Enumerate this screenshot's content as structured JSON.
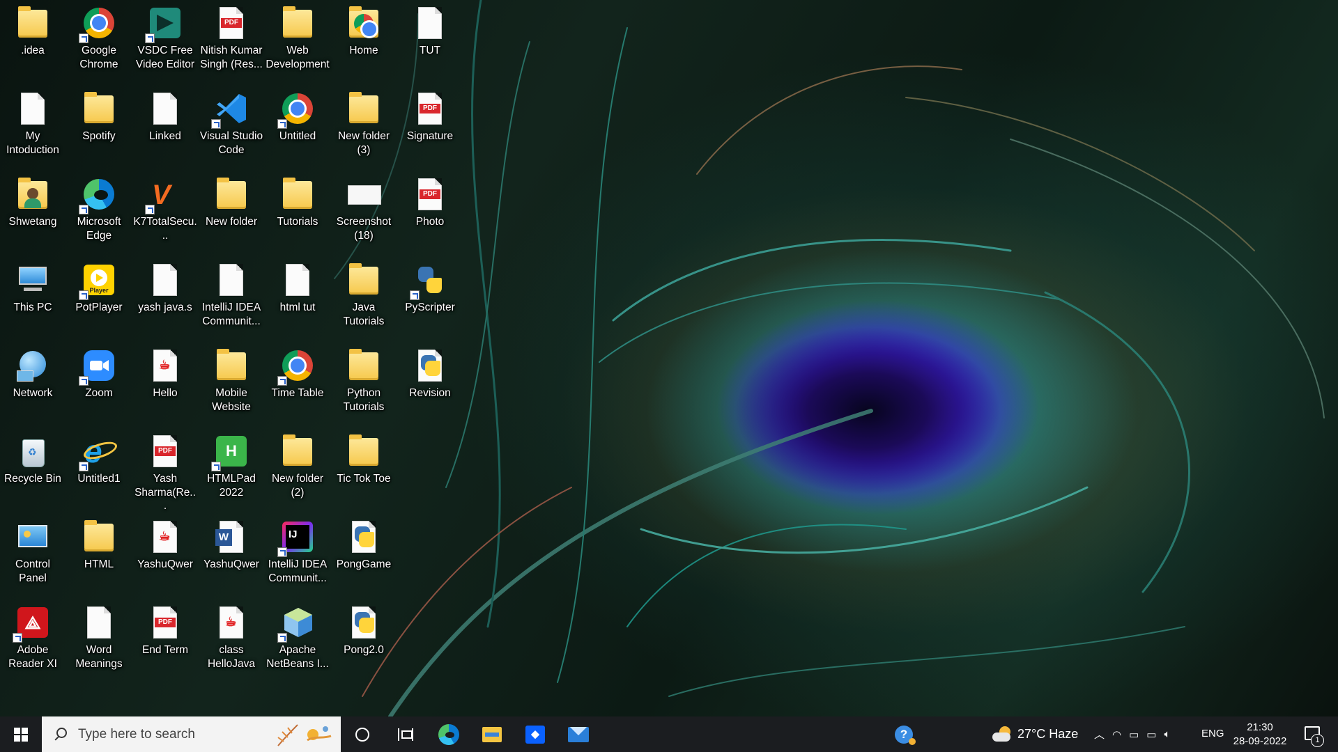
{
  "desktop": {
    "icons": [
      {
        "label": ".idea",
        "kind": "folder-icon"
      },
      {
        "label": "Google Chrome",
        "kind": "chrome-icon"
      },
      {
        "label": "VSDC Free Video Editor",
        "kind": "vsdc-icon"
      },
      {
        "label": "Nitish Kumar Singh (Res...",
        "kind": "pdf-icon"
      },
      {
        "label": "Web Development",
        "kind": "folder-icon"
      },
      {
        "label": "Home",
        "kind": "folder-chrome-icon"
      },
      {
        "label": "TUT",
        "kind": "document-icon"
      },
      {
        "label": "My Intoduction",
        "kind": "document-icon"
      },
      {
        "label": "Spotify",
        "kind": "folder-icon"
      },
      {
        "label": "Linked",
        "kind": "document-icon"
      },
      {
        "label": "Visual Studio Code",
        "kind": "vscode-icon"
      },
      {
        "label": "Untitled",
        "kind": "chrome-icon"
      },
      {
        "label": "New folder (3)",
        "kind": "folder-icon"
      },
      {
        "label": "Signature",
        "kind": "pdf-icon"
      },
      {
        "label": "Shwetang",
        "kind": "user-folder-icon"
      },
      {
        "label": "Microsoft Edge",
        "kind": "edge-icon"
      },
      {
        "label": "K7TotalSecu...",
        "kind": "k7-icon"
      },
      {
        "label": "New folder",
        "kind": "folder-icon"
      },
      {
        "label": "Tutorials",
        "kind": "folder-icon"
      },
      {
        "label": "Screenshot (18)",
        "kind": "image-icon"
      },
      {
        "label": "Photo",
        "kind": "pdf-icon"
      },
      {
        "label": "This PC",
        "kind": "computer-icon"
      },
      {
        "label": "PotPlayer",
        "kind": "potplayer-icon"
      },
      {
        "label": "yash java.s",
        "kind": "document-icon"
      },
      {
        "label": "IntelliJ IDEA Communit...",
        "kind": "document-icon"
      },
      {
        "label": "html tut",
        "kind": "document-icon"
      },
      {
        "label": "Java Tutorials",
        "kind": "folder-icon"
      },
      {
        "label": "PyScripter",
        "kind": "pyscripter-icon"
      },
      {
        "label": "Network",
        "kind": "network-icon"
      },
      {
        "label": "Zoom",
        "kind": "zoom-icon"
      },
      {
        "label": "Hello",
        "kind": "java-file-icon"
      },
      {
        "label": "Mobile Website",
        "kind": "folder-icon"
      },
      {
        "label": "Time Table",
        "kind": "chrome-icon"
      },
      {
        "label": "Python Tutorials",
        "kind": "folder-icon"
      },
      {
        "label": "Revision",
        "kind": "python-file-icon"
      },
      {
        "label": "Recycle Bin",
        "kind": "recycle-bin-icon"
      },
      {
        "label": "Untitled1",
        "kind": "ie-icon"
      },
      {
        "label": "Yash Sharma(Re...",
        "kind": "pdf-icon"
      },
      {
        "label": "HTMLPad 2022",
        "kind": "htmlpad-icon"
      },
      {
        "label": "New folder (2)",
        "kind": "folder-icon"
      },
      {
        "label": "Tic Tok Toe",
        "kind": "folder-icon"
      },
      {
        "label": "Control Panel",
        "kind": "control-panel-icon"
      },
      {
        "label": "HTML",
        "kind": "folder-icon"
      },
      {
        "label": "YashuQwer",
        "kind": "java-file-icon"
      },
      {
        "label": "YashuQwer",
        "kind": "word-icon"
      },
      {
        "label": "IntelliJ IDEA Communit...",
        "kind": "intellij-icon"
      },
      {
        "label": "PongGame",
        "kind": "python-file-icon"
      },
      {
        "label": "Adobe Reader XI",
        "kind": "adobe-icon"
      },
      {
        "label": "Word Meanings",
        "kind": "document-icon"
      },
      {
        "label": "End Term",
        "kind": "pdf-icon"
      },
      {
        "label": "class HelloJava",
        "kind": "java-file-icon"
      },
      {
        "label": "Apache NetBeans I...",
        "kind": "netbeans-icon"
      },
      {
        "label": "Pong2.0",
        "kind": "python-file-icon"
      }
    ]
  },
  "taskbar": {
    "search_placeholder": "Type here to search",
    "weather": "27°C  Haze",
    "language": "ENG",
    "time": "21:30",
    "date": "28-09-2022",
    "notification_count": "1",
    "pdf_badge": "PDF"
  }
}
